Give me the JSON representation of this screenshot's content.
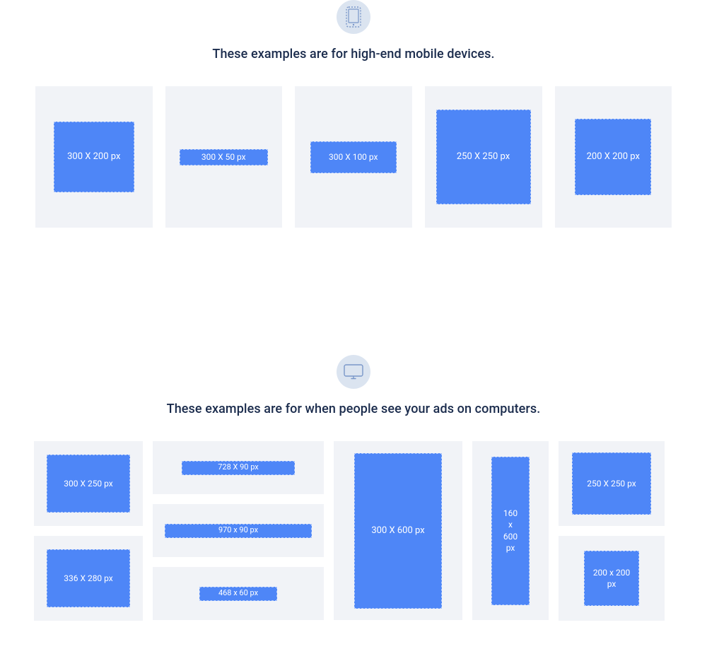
{
  "mobile": {
    "title": "These examples are for high-end mobile devices.",
    "iconName": "mobile-icon",
    "items": [
      {
        "label": "300 X 200 px"
      },
      {
        "label": "300 X 50 px"
      },
      {
        "label": "300 X 100 px"
      },
      {
        "label": "250 X 250 px"
      },
      {
        "label": "200 X 200 px"
      }
    ]
  },
  "computer": {
    "title": "These examples are for when people see your ads on computers.",
    "iconName": "monitor-icon",
    "colA": [
      {
        "label": "300 X 250 px"
      },
      {
        "label": "336 X 280 px"
      }
    ],
    "colB": [
      {
        "label": "728 X 90 px"
      },
      {
        "label": "970 x 90 px"
      },
      {
        "label": "468 x 60 px"
      }
    ],
    "colC": {
      "label": "300 X 600 px"
    },
    "colD": {
      "label": "160\nx\n600\npx"
    },
    "colE": [
      {
        "label": "250 X 250 px"
      },
      {
        "label": "200 x 200\npx"
      }
    ]
  }
}
